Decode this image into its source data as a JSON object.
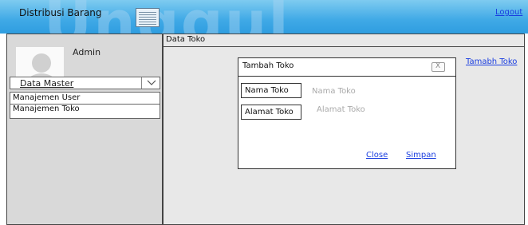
{
  "header": {
    "app_title": "Distribusi Barang",
    "logout_label": "Logout",
    "watermark_text": "Unggul"
  },
  "sidebar": {
    "user_name": "Admin",
    "master_select_value": "Data Master",
    "submenu": {
      "manage_user": "Manajemen User",
      "manage_store": "Manajemen Toko"
    }
  },
  "main": {
    "title": "Data Toko",
    "add_store_link": "Tamabh Toko"
  },
  "modal": {
    "title": "Tambah Toko",
    "close_x": "X",
    "store_name_label": "Nama Toko",
    "store_name_placeholder": "Nama Toko",
    "store_address_label": "Alamat Toko",
    "store_address_placeholder": "Alamat Toko",
    "close_label": "Close",
    "save_label": "Simpan"
  },
  "colors": {
    "header_blue": "#3fa9e6",
    "link_blue": "#1a3ee0",
    "sidebar_gray": "#d9d9d9"
  },
  "icons": {
    "menu": "hamburger-menu-icon",
    "avatar": "user-avatar-icon",
    "dropdown": "chevron-down-icon",
    "close": "close-icon"
  }
}
